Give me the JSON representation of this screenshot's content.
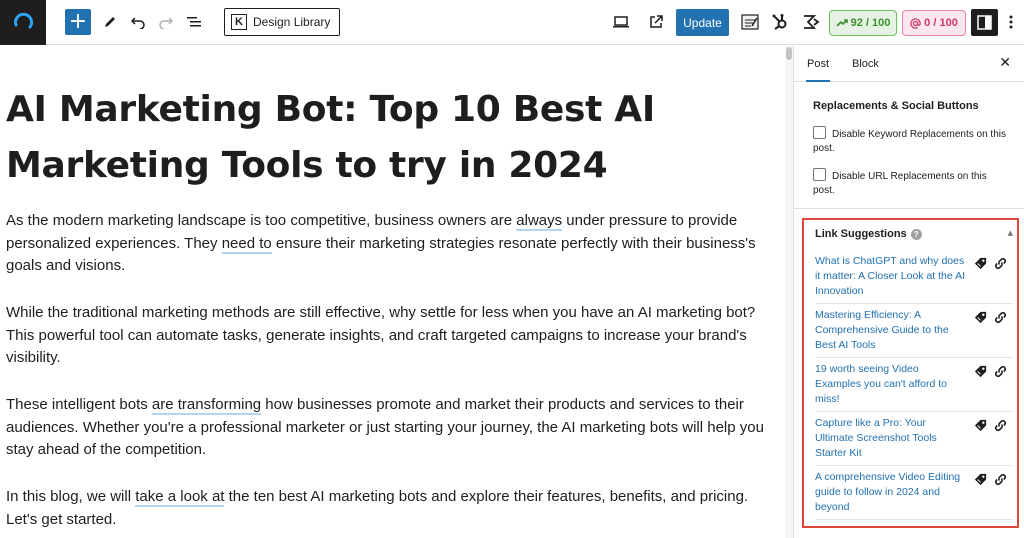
{
  "toolbar": {
    "design_library_label": "Design Library",
    "update_label": "Update",
    "seo_score": "92 / 100",
    "readability_score": "0 / 100"
  },
  "post": {
    "title": "AI Marketing Bot: Top 10 Best AI Marketing Tools to try in 2024",
    "p1_a": "As the modern marketing landscape is too competitive, business owners are ",
    "p1_link1": "always",
    "p1_b": " under pressure to provide personalized experiences. They ",
    "p1_link2": "need to",
    "p1_c": " ensure their marketing strategies resonate perfectly with their business's goals and visions.",
    "p2": "While the traditional marketing methods are still effective, why settle for less when you have an AI marketing bot? This powerful tool can automate tasks, generate insights, and craft targeted campaigns to increase your brand's visibility.",
    "p3_a": "These intelligent bots ",
    "p3_link": "are transforming",
    "p3_b": " how businesses promote and market their products and services to their audiences. Whether you're a professional marketer or just starting your journey, the AI marketing bots will help you stay ahead of the competition.",
    "p4_a": "In this blog, we will ",
    "p4_link": "take a look at",
    "p4_b": " the ten best AI marketing bots and explore their features, benefits, and pricing. Let's get started."
  },
  "sidebar": {
    "tab_post": "Post",
    "tab_block": "Block",
    "close_symbol": "✕",
    "replacements_heading": "Replacements & Social Buttons",
    "cb_keyword": "Disable Keyword Replacements on this post.",
    "cb_url": "Disable URL Replacements on this post.",
    "link_suggestions_title": "Link Suggestions",
    "suggestions": [
      {
        "text": "What is ChatGPT and why does it matter: A Closer Look at the AI Innovation"
      },
      {
        "text": "Mastering Efficiency: A Comprehensive Guide to the Best AI Tools"
      },
      {
        "text": "19 worth seeing Video Examples you can't afford to miss!"
      },
      {
        "text": "Capture like a Pro: Your Ultimate Screenshot Tools Starter Kit"
      },
      {
        "text": "A comprehensive Video Editing guide to follow in 2024 and beyond"
      }
    ]
  },
  "colors": {
    "accent": "#2271b1",
    "highlight_box": "#e0443a",
    "seo_green": "#3b8f2c",
    "readability_pink": "#c8396a"
  }
}
